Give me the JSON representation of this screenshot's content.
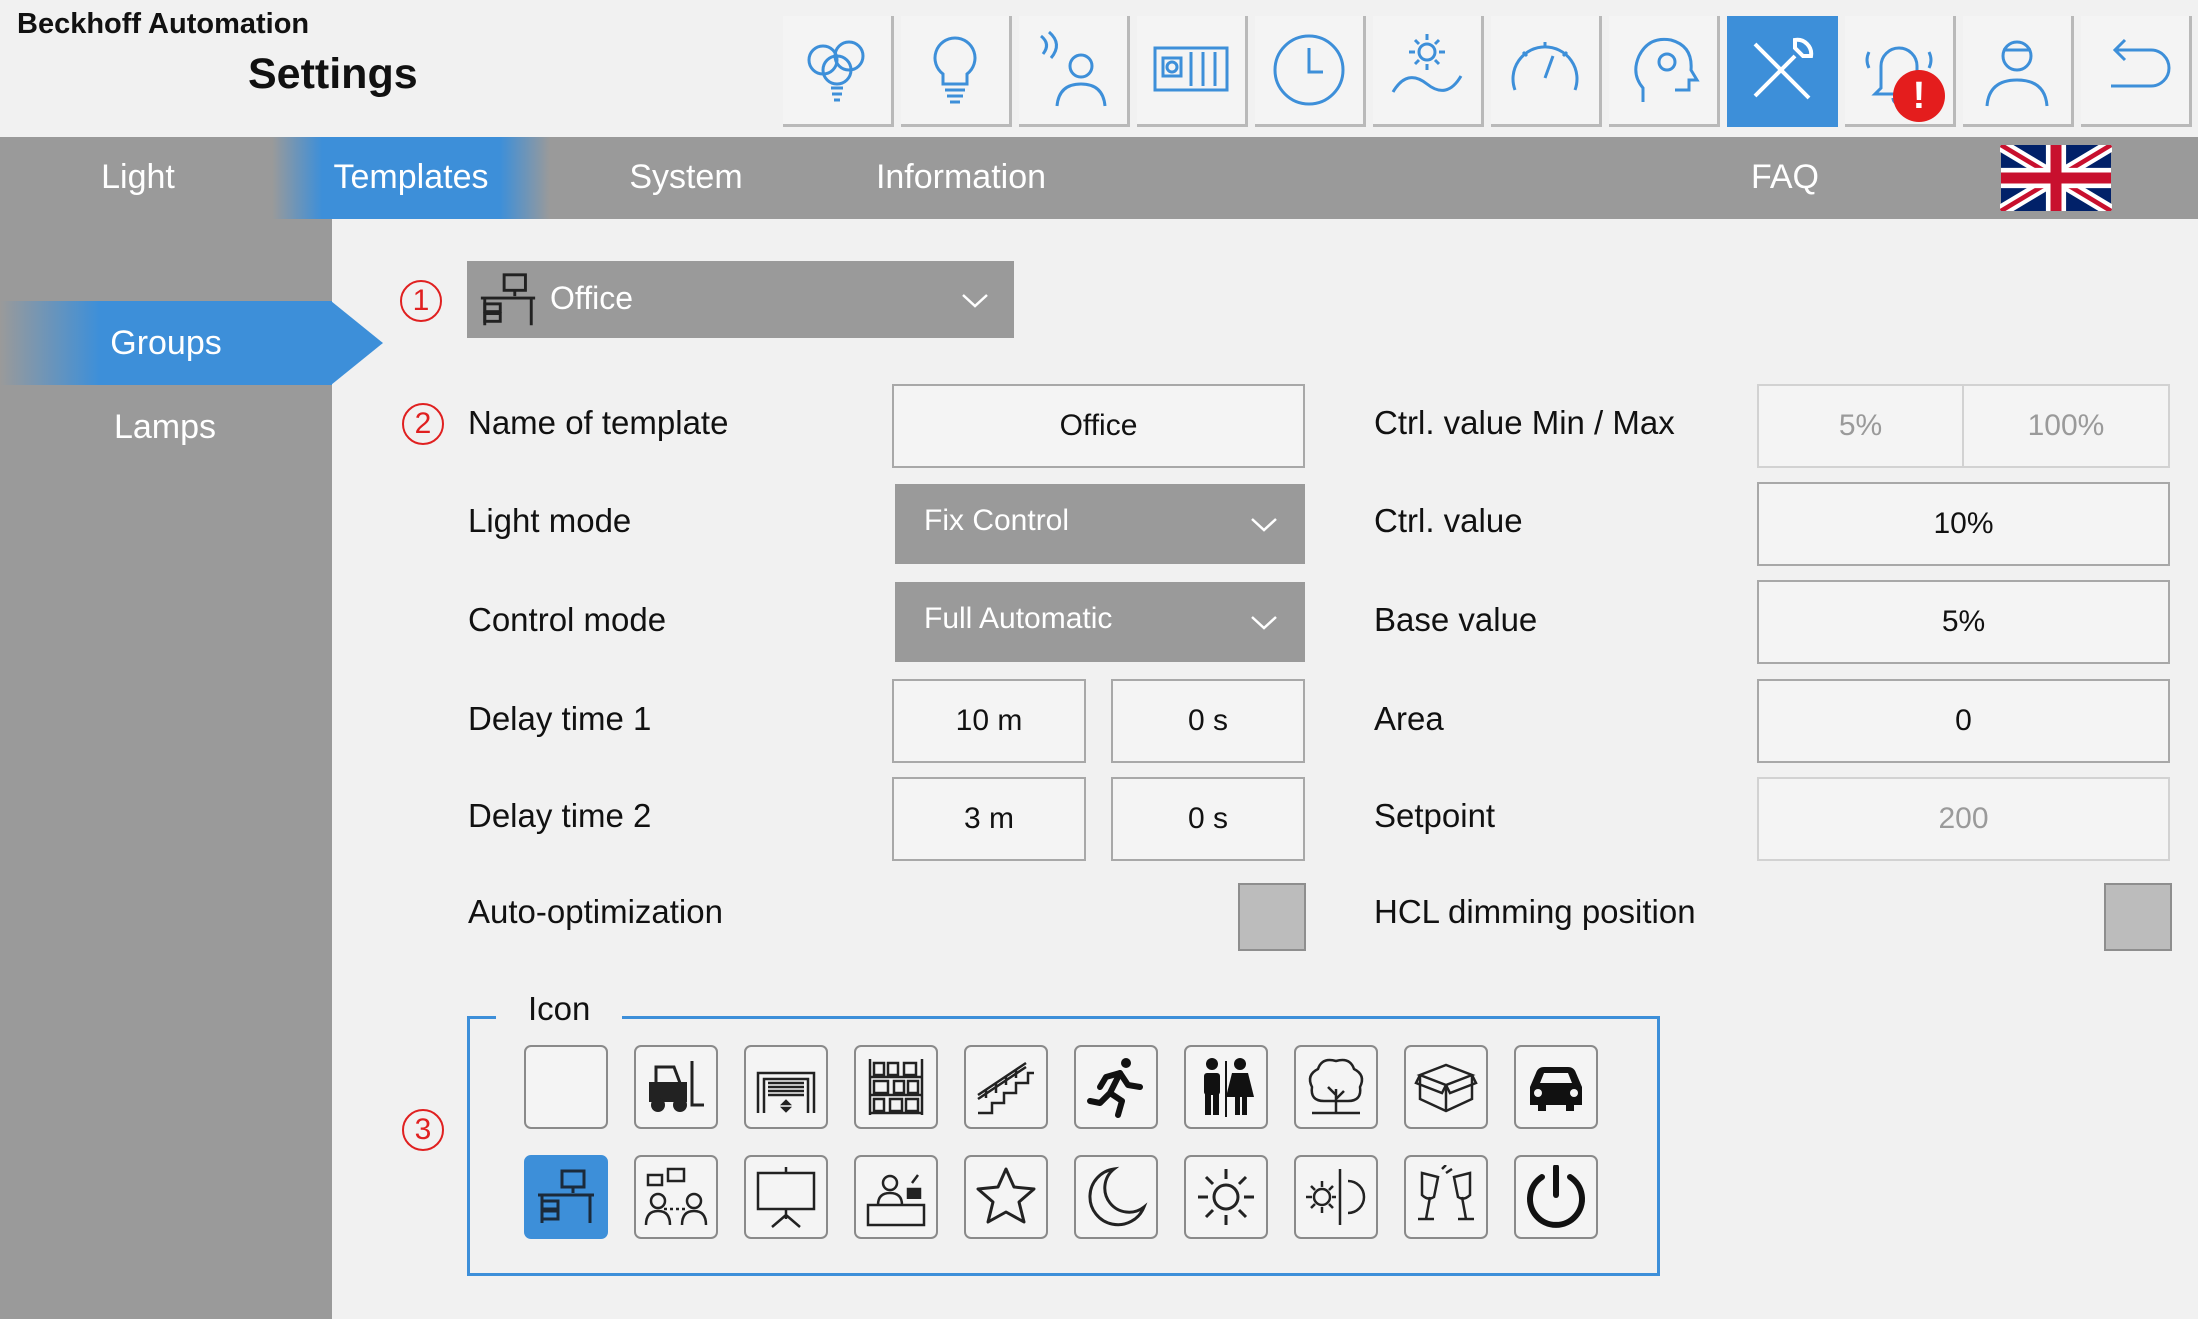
{
  "app": {
    "company": "Beckhoff Automation",
    "title": "Settings"
  },
  "toolbar": {
    "buttons": [
      {
        "name": "scenes-icon",
        "active": false
      },
      {
        "name": "light-icon",
        "active": false
      },
      {
        "name": "presence-icon",
        "active": false
      },
      {
        "name": "blind-icon",
        "active": false
      },
      {
        "name": "clock-icon",
        "active": false
      },
      {
        "name": "daylight-icon",
        "active": false
      },
      {
        "name": "gauge-icon",
        "active": false
      },
      {
        "name": "settings-head-icon",
        "active": false
      },
      {
        "name": "tools-icon",
        "active": true
      },
      {
        "name": "alarm-bell-icon",
        "active": false,
        "badge": "!"
      },
      {
        "name": "user-icon",
        "active": false
      },
      {
        "name": "back-icon",
        "active": false
      }
    ]
  },
  "nav": {
    "tabs": [
      {
        "label": "Light"
      },
      {
        "label": "Templates",
        "active": true
      },
      {
        "label": "System"
      },
      {
        "label": "Information"
      },
      {
        "label": "FAQ"
      }
    ],
    "language": "uk-flag-icon"
  },
  "sidebar": {
    "items": [
      {
        "label": "Groups",
        "active": true
      },
      {
        "label": "Lamps"
      }
    ]
  },
  "markers": [
    "1",
    "2",
    "3"
  ],
  "template_select": {
    "value": "Office",
    "icon": "office-desk-icon"
  },
  "form": {
    "name_of_template": {
      "label": "Name of template",
      "value": "Office"
    },
    "light_mode": {
      "label": "Light mode",
      "value": "Fix Control"
    },
    "control_mode": {
      "label": "Control mode",
      "value": "Full Automatic"
    },
    "delay_time_1": {
      "label": "Delay time 1",
      "minutes": "10 m",
      "seconds": "0 s"
    },
    "delay_time_2": {
      "label": "Delay time 2",
      "minutes": "3 m",
      "seconds": "0 s"
    },
    "auto_optimization": {
      "label": "Auto-optimization",
      "checked": false
    },
    "ctrl_value_min_max": {
      "label": "Ctrl. value Min / Max",
      "min": "5%",
      "max": "100%"
    },
    "ctrl_value": {
      "label": "Ctrl. value",
      "value": "10%"
    },
    "base_value": {
      "label": "Base value",
      "value": "5%"
    },
    "area": {
      "label": "Area",
      "value": "0"
    },
    "setpoint": {
      "label": "Setpoint",
      "value": "200"
    },
    "hcl_dimming_position": {
      "label": "HCL dimming position",
      "checked": false
    }
  },
  "icon_picker": {
    "legend": "Icon",
    "selected": "office-desk-icon",
    "row1": [
      "blank-icon",
      "forklift-icon",
      "garage-door-icon",
      "shelves-icon",
      "stairs-icon",
      "running-man-icon",
      "restroom-icon",
      "tree-icon",
      "box-icon",
      "car-icon"
    ],
    "row2": [
      "office-desk-icon",
      "meeting-icon",
      "presentation-icon",
      "reception-icon",
      "star-icon",
      "moon-icon",
      "sun-icon",
      "sun-moon-icon",
      "cheers-icon",
      "power-icon"
    ]
  },
  "colors": {
    "accent": "#3d8fd9",
    "nav": "#9a9a9a",
    "marker": "#e02020",
    "background": "#f1f1f1"
  }
}
